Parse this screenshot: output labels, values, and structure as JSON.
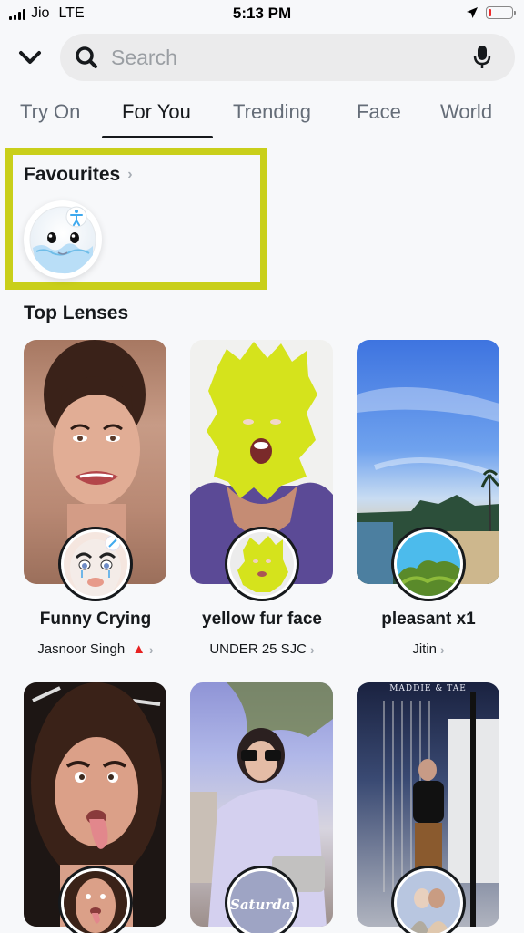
{
  "status_bar": {
    "carrier": "Jio",
    "network": "LTE",
    "time": "5:13 PM",
    "battery_level": 0.1,
    "battery_color": "#ee2b2b"
  },
  "search": {
    "placeholder": "Search",
    "value": "",
    "back_icon": "chevron-down-icon",
    "search_icon": "search-icon",
    "mic_icon": "microphone-icon"
  },
  "tabs": [
    {
      "label": "Try On",
      "active": false
    },
    {
      "label": "For You",
      "active": true
    },
    {
      "label": "Trending",
      "active": false
    },
    {
      "label": "Face",
      "active": false
    },
    {
      "label": "World",
      "active": false
    }
  ],
  "favourites": {
    "title": "Favourites",
    "chevron": "›",
    "highlight_color": "#c9cf1a",
    "items": [
      {
        "name": "bubble face lens",
        "badge_icon": "accessibility-person-icon"
      }
    ]
  },
  "top_lenses": {
    "title": "Top Lenses",
    "cards": [
      {
        "name": "Funny Crying",
        "creator": "Jasnoor Singh",
        "creator_badge": "▲",
        "chevron": "›"
      },
      {
        "name": "yellow fur face",
        "creator": "UNDER 25 SJC",
        "chevron": "›"
      },
      {
        "name": "pleasant x1",
        "creator": "Jitin",
        "chevron": "›"
      },
      {
        "name": "",
        "creator": ""
      },
      {
        "name": "",
        "creator": "",
        "overlay_text": "Saturday"
      },
      {
        "name": "",
        "creator": "",
        "overlay_text": "MADDIE & TAE"
      }
    ]
  }
}
